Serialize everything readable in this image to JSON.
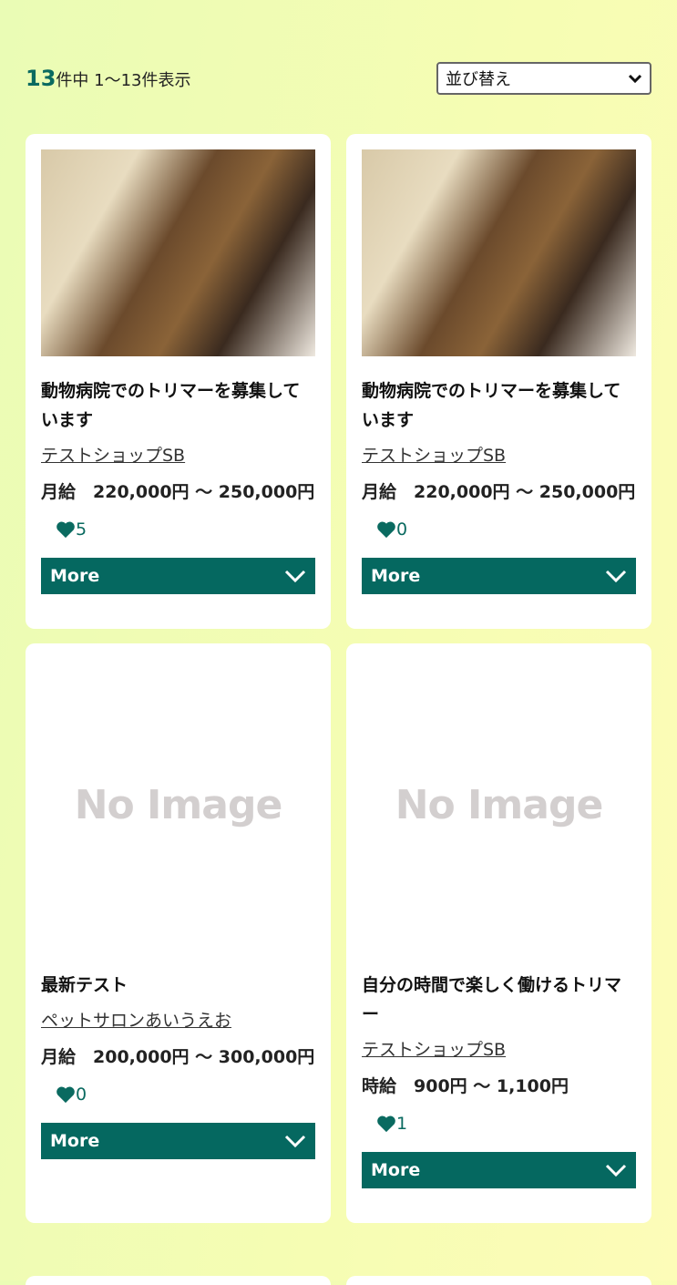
{
  "header": {
    "total": "13",
    "count_text": "件中 1〜13件表示",
    "sort_label": "並び替え"
  },
  "jobs": [
    {
      "image": "photo",
      "title": "動物病院でのトリマーを募集しています",
      "shop": "テストショップSB",
      "salary": "月給　220,000円 〜 250,000円",
      "likes": "5",
      "more": "More"
    },
    {
      "image": "photo",
      "title": "動物病院でのトリマーを募集しています",
      "shop": "テストショップSB",
      "salary": "月給　220,000円 〜 250,000円",
      "likes": "0",
      "more": "More"
    },
    {
      "image": "No Image",
      "title": "最新テスト",
      "shop": "ペットサロンあいうえお",
      "salary": "月給　200,000円 〜 300,000円",
      "likes": "0",
      "more": "More"
    },
    {
      "image": "No Image",
      "title": "自分の時間で楽しく働けるトリマー",
      "shop": "テストショップSB",
      "salary": "時給　900円 〜 1,100円",
      "likes": "1",
      "more": "More"
    }
  ],
  "colors": {
    "accent": "#056860",
    "background": "#f2fcb6"
  }
}
